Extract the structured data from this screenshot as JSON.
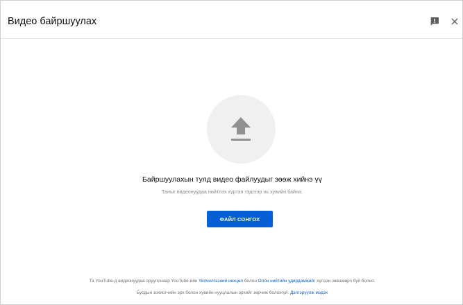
{
  "dialog": {
    "title": "Видео байршуулах"
  },
  "header_icons": {
    "feedback": "feedback-icon",
    "close": "close-icon"
  },
  "upload": {
    "icon": "upload-arrow-icon",
    "main_text": "Байршуулахын тулд видео файлуудыг зөөж хийнэ үү",
    "sub_text": "Таныг видеонуудаа нийтлэх хүртэл тэдгээр нь хувийн байна.",
    "button_label": "ФАЙЛ СОНГОХ"
  },
  "footer": {
    "line1_part1": "Та YouTube-д видеонуудаа оруулснаар YouTube-ийн ",
    "terms_link": "Үйлчилгээний нөхцөл",
    "line1_part2": " болон ",
    "guidelines_link": "Олон нийтийн удирдамжийг",
    "line1_part3": " хүлээн зөвшөөрч буй болно.",
    "line2_part1": "Бусдын зохиогчийн эрх болон хувийн нууцлалын эрхийг зөрчиж болохгүй. ",
    "learn_more_link": "Дэлгэрүүлж мэдэх"
  },
  "colors": {
    "accent": "#065fd4",
    "circle_bg": "#f0f0f0",
    "icon_gray": "#909090"
  }
}
